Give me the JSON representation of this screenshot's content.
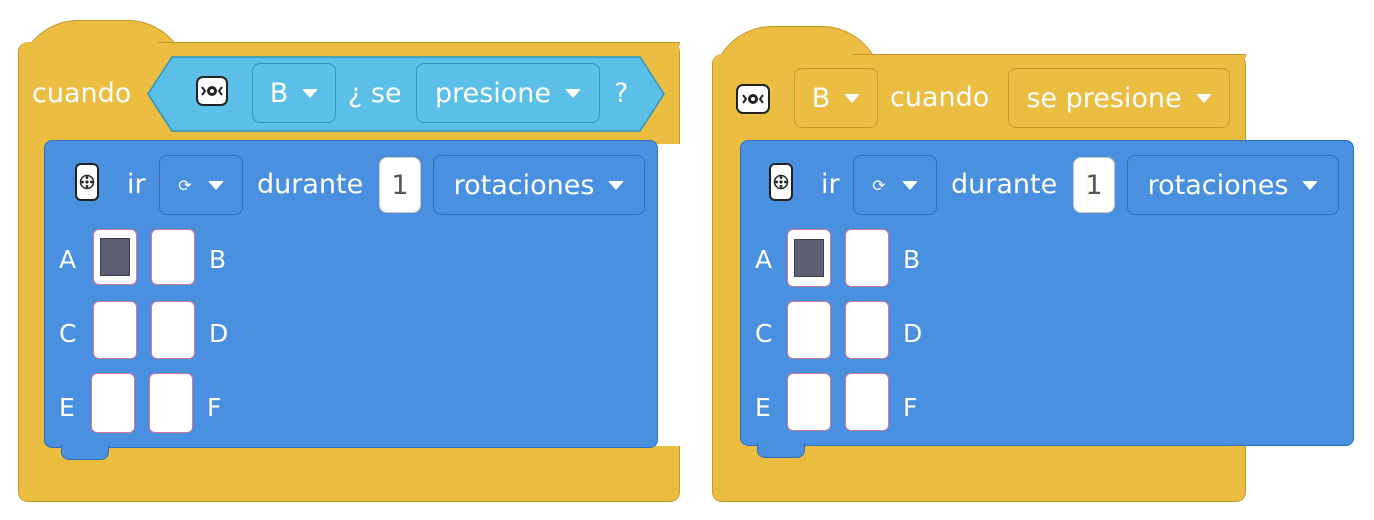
{
  "block1": {
    "when_label": "cuando",
    "port": "B",
    "question_prefix": "¿ se",
    "event": "presione",
    "question_suffix": "?",
    "action": {
      "go_label": "ir",
      "direction_symbol": "⟳",
      "for_label": "durante",
      "amount": "1",
      "unit": "rotaciones"
    },
    "ports": [
      "A",
      "B",
      "C",
      "D",
      "E",
      "F"
    ],
    "selected_port": "A"
  },
  "block2": {
    "port": "B",
    "when_label": "cuando",
    "event": "se presione",
    "action": {
      "go_label": "ir",
      "direction_symbol": "⟳",
      "for_label": "durante",
      "amount": "1",
      "unit": "rotaciones"
    },
    "ports": [
      "A",
      "B",
      "C",
      "D",
      "E",
      "F"
    ],
    "selected_port": "A"
  },
  "colors": {
    "event_yellow": "#ebbd40",
    "motor_blue": "#4a90e0",
    "sensor_cyan": "#5bc0e8"
  },
  "icons": {
    "event_device": "button-device-icon",
    "motor_device": "motor-device-icon"
  }
}
